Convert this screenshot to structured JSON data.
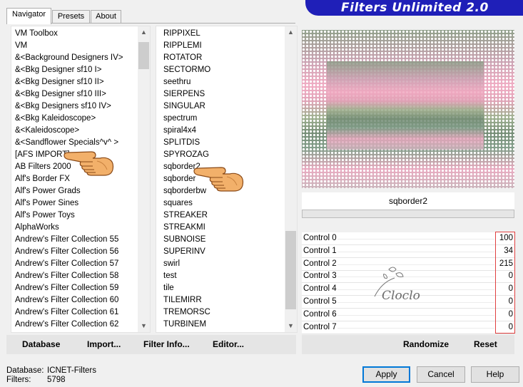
{
  "tabs": [
    {
      "label": "Navigator",
      "active": true
    },
    {
      "label": "Presets",
      "active": false
    },
    {
      "label": "About",
      "active": false
    }
  ],
  "banner": {
    "title": "Filters Unlimited 2.0",
    "color": "#1f1fb8"
  },
  "categories": {
    "items": [
      "VM Toolbox",
      "VM",
      "&<Background Designers IV>",
      "&<Bkg Designer sf10 I>",
      "&<Bkg Designer sf10 II>",
      "&<Bkg Designer sf10 III>",
      "&<Bkg Designers sf10 IV>",
      "&<Bkg Kaleidoscope>",
      "&<Kaleidoscope>",
      "&<Sandflower Specials^v^ >",
      "[AFS IMPORT]",
      "AB Filters 2000",
      "Alf's Border FX",
      "Alf's Power Grads",
      "Alf's Power Sines",
      "Alf's Power Toys",
      "AlphaWorks",
      "Andrew's Filter Collection 55",
      "Andrew's Filter Collection 56",
      "Andrew's Filter Collection 57",
      "Andrew's Filter Collection 58",
      "Andrew's Filter Collection 59",
      "Andrew's Filter Collection 60",
      "Andrew's Filter Collection 61",
      "Andrew's Filter Collection 62"
    ],
    "selected": "[AFS IMPORT]"
  },
  "filters": {
    "items": [
      "RIPPIXEL",
      "RIPPLEMI",
      "ROTATOR",
      "SECTORMO",
      "seethru",
      "SIERPENS",
      "SINGULAR",
      "spectrum",
      "spiral4x4",
      "SPLITDIS",
      "SPYROZAG",
      "sqborder2",
      "sqborder",
      "sqborderbw",
      "squares",
      "STREAKER",
      "STREAKMI",
      "SUBNOISE",
      "SUPERINV",
      "swirl",
      "test",
      "tile",
      "TILEMIRR",
      "TREMORSC",
      "TURBINEM"
    ],
    "selected": "sqborder2"
  },
  "toolbar": {
    "database": "Database",
    "import": "Import...",
    "filter_info": "Filter Info...",
    "editor": "Editor...",
    "randomize": "Randomize",
    "reset": "Reset"
  },
  "preview": {
    "filter_name": "sqborder2"
  },
  "controls": [
    {
      "label": "Control 0",
      "value": "100"
    },
    {
      "label": "Control 1",
      "value": "34"
    },
    {
      "label": "Control 2",
      "value": "215"
    },
    {
      "label": "Control 3",
      "value": "0"
    },
    {
      "label": "Control 4",
      "value": "0"
    },
    {
      "label": "Control 5",
      "value": "0"
    },
    {
      "label": "Control 6",
      "value": "0"
    },
    {
      "label": "Control 7",
      "value": "0"
    }
  ],
  "status": {
    "database_label": "Database:",
    "database_value": "ICNET-Filters",
    "filters_label": "Filters:",
    "filters_value": "5798"
  },
  "buttons": {
    "apply": "Apply",
    "cancel": "Cancel",
    "help": "Help"
  },
  "watermark": {
    "text": "Cloclo"
  },
  "colors": {
    "accent": "#0078d7",
    "highlight_box": "#e04040"
  }
}
